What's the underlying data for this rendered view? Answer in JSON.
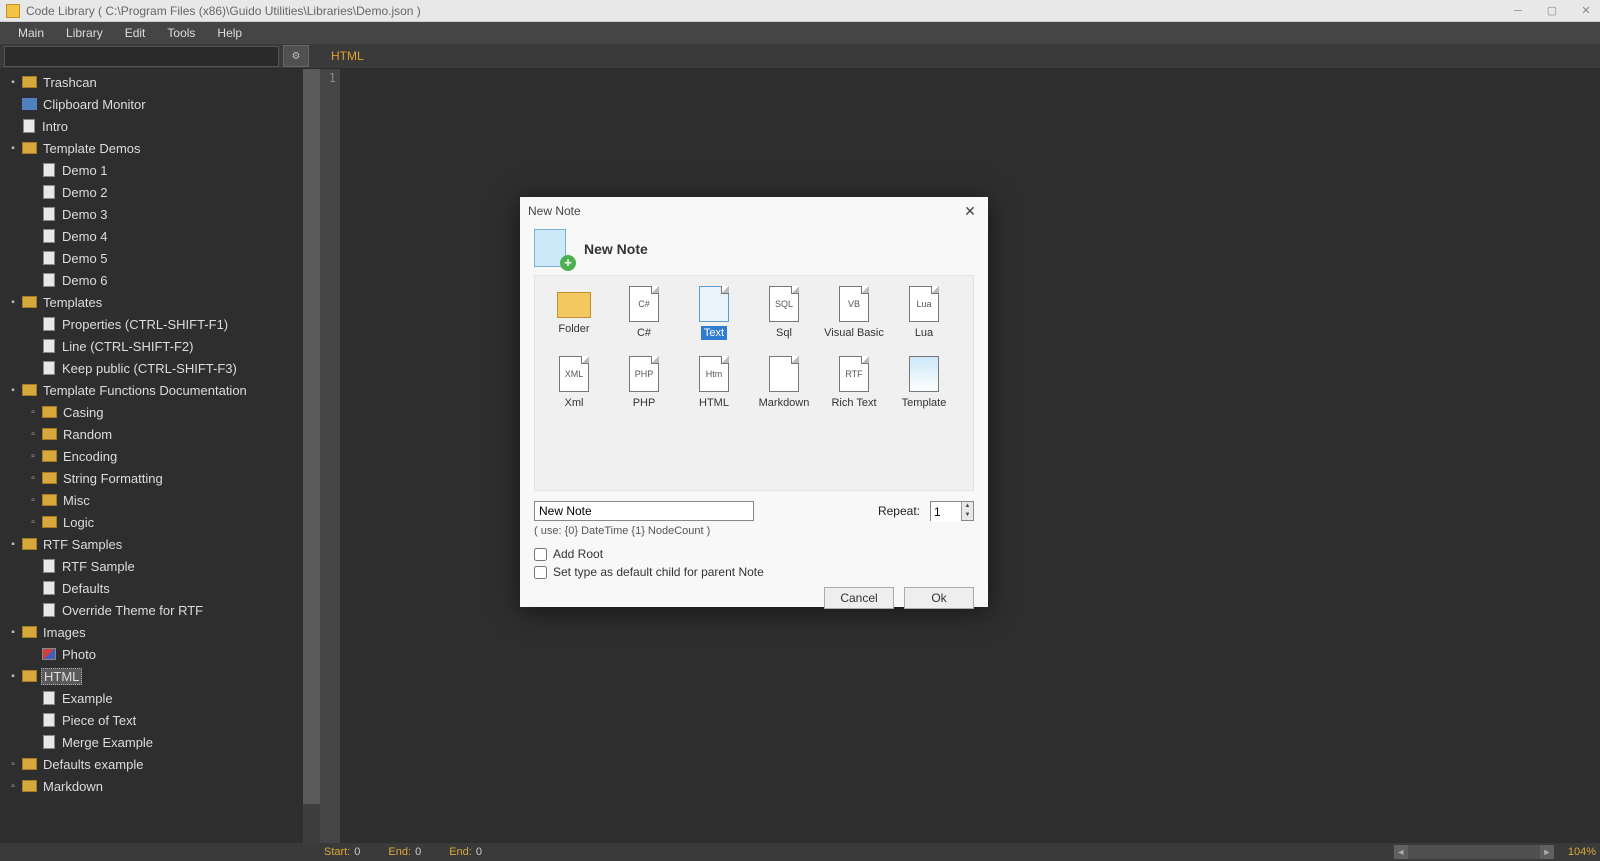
{
  "title": "Code Library ( C:\\Program Files (x86)\\Guido Utilities\\Libraries\\Demo.json )",
  "menus": [
    "Main",
    "Library",
    "Edit",
    "Tools",
    "Help"
  ],
  "tab_label": "HTML",
  "gutter_line": "1",
  "tree": [
    {
      "ind": 1,
      "exp": "▣",
      "icon": "folder",
      "label": "Trashcan"
    },
    {
      "ind": 1,
      "exp": "",
      "icon": "special",
      "label": "Clipboard Monitor"
    },
    {
      "ind": 1,
      "exp": "",
      "icon": "file",
      "label": "Intro"
    },
    {
      "ind": 1,
      "exp": "▣",
      "icon": "folder",
      "label": "Template Demos"
    },
    {
      "ind": 2,
      "exp": "",
      "icon": "file",
      "label": "Demo 1"
    },
    {
      "ind": 2,
      "exp": "",
      "icon": "file",
      "label": "Demo 2"
    },
    {
      "ind": 2,
      "exp": "",
      "icon": "file",
      "label": "Demo 3"
    },
    {
      "ind": 2,
      "exp": "",
      "icon": "file",
      "label": "Demo 4"
    },
    {
      "ind": 2,
      "exp": "",
      "icon": "file",
      "label": "Demo 5"
    },
    {
      "ind": 2,
      "exp": "",
      "icon": "file",
      "label": "Demo 6"
    },
    {
      "ind": 1,
      "exp": "▣",
      "icon": "folder",
      "label": "Templates"
    },
    {
      "ind": 2,
      "exp": "",
      "icon": "file",
      "label": "Properties (CTRL-SHIFT-F1)"
    },
    {
      "ind": 2,
      "exp": "",
      "icon": "file",
      "label": "Line (CTRL-SHIFT-F2)"
    },
    {
      "ind": 2,
      "exp": "",
      "icon": "file",
      "label": "Keep public (CTRL-SHIFT-F3)"
    },
    {
      "ind": 1,
      "exp": "▣",
      "icon": "folder",
      "label": "Template Functions Documentation"
    },
    {
      "ind": 2,
      "exp": "▫",
      "icon": "folder",
      "label": "Casing"
    },
    {
      "ind": 2,
      "exp": "▫",
      "icon": "folder",
      "label": "Random"
    },
    {
      "ind": 2,
      "exp": "▫",
      "icon": "folder",
      "label": "Encoding"
    },
    {
      "ind": 2,
      "exp": "▫",
      "icon": "folder",
      "label": "String Formatting"
    },
    {
      "ind": 2,
      "exp": "▫",
      "icon": "folder",
      "label": "Misc"
    },
    {
      "ind": 2,
      "exp": "▫",
      "icon": "folder",
      "label": "Logic"
    },
    {
      "ind": 1,
      "exp": "▣",
      "icon": "folder",
      "label": "RTF Samples"
    },
    {
      "ind": 2,
      "exp": "",
      "icon": "file",
      "label": "RTF Sample"
    },
    {
      "ind": 2,
      "exp": "",
      "icon": "file",
      "label": "Defaults"
    },
    {
      "ind": 2,
      "exp": "",
      "icon": "file",
      "label": "Override Theme for RTF"
    },
    {
      "ind": 1,
      "exp": "▣",
      "icon": "folder",
      "label": "Images"
    },
    {
      "ind": 2,
      "exp": "",
      "icon": "photo",
      "label": "Photo"
    },
    {
      "ind": 1,
      "exp": "▣",
      "icon": "folder",
      "label": "HTML",
      "selected": true
    },
    {
      "ind": 2,
      "exp": "",
      "icon": "file",
      "label": "Example"
    },
    {
      "ind": 2,
      "exp": "",
      "icon": "file",
      "label": "Piece of Text"
    },
    {
      "ind": 2,
      "exp": "",
      "icon": "file",
      "label": "Merge Example"
    },
    {
      "ind": 1,
      "exp": "▫",
      "icon": "folder",
      "label": "Defaults example"
    },
    {
      "ind": 1,
      "exp": "▫",
      "icon": "folder",
      "label": "Markdown"
    }
  ],
  "status": {
    "start_label": "Start:",
    "start_val": "0",
    "end1_label": "End:",
    "end1_val": "0",
    "end2_label": "End:",
    "end2_val": "0",
    "zoom": "104%"
  },
  "dialog": {
    "title": "New Note",
    "heading": "New Note",
    "types": [
      {
        "label": "Folder",
        "icon": "folder"
      },
      {
        "label": "C#",
        "icon": "C#"
      },
      {
        "label": "Text",
        "icon": "",
        "selected": true
      },
      {
        "label": "Sql",
        "icon": "SQL"
      },
      {
        "label": "Visual Basic",
        "icon": "VB"
      },
      {
        "label": "Lua",
        "icon": "Lua"
      },
      {
        "label": "Xml",
        "icon": "XML"
      },
      {
        "label": "PHP",
        "icon": "PHP"
      },
      {
        "label": "HTML",
        "icon": "Htm"
      },
      {
        "label": "Markdown",
        "icon": ""
      },
      {
        "label": "Rich Text",
        "icon": "RTF"
      },
      {
        "label": "Template",
        "icon": "tpl"
      }
    ],
    "name_value": "New Note",
    "hint": "( use: {0} DateTime {1} NodeCount )",
    "repeat_label": "Repeat:",
    "repeat_value": "1",
    "check_addroot": "Add Root",
    "check_default": "Set type as default child for parent Note",
    "btn_cancel": "Cancel",
    "btn_ok": "Ok"
  }
}
